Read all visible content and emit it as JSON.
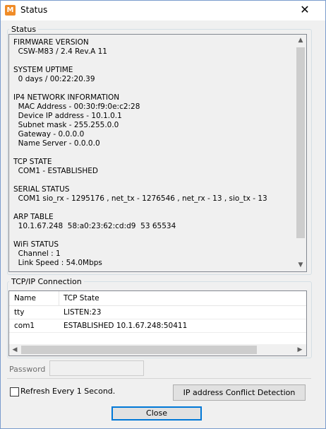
{
  "window": {
    "title": "Status",
    "icon_letter": "M"
  },
  "status_group": {
    "legend": "Status",
    "lines": [
      "FIRMWARE VERSION",
      "  CSW-M83 / 2.4 Rev.A 11",
      "",
      "SYSTEM UPTIME",
      "  0 days / 00:22:20.39",
      "",
      "IP4 NETWORK INFORMATION",
      "  MAC Address - 00:30:f9:0e:c2:28",
      "  Device IP address - 10.1.0.1",
      "  Subnet mask - 255.255.0.0",
      "  Gateway - 0.0.0.0",
      "  Name Server - 0.0.0.0",
      "",
      "TCP STATE",
      "  COM1 - ESTABLISHED",
      "",
      "SERIAL STATUS",
      "  COM1 sio_rx - 1295176 , net_tx - 1276546 , net_rx - 13 , sio_tx - 13",
      "",
      "ARP TABLE",
      "  10.1.67.248  58:a0:23:62:cd:d9  53 65534",
      "",
      "WiFi STATUS",
      "  Channel : 1",
      "  Link Speed : 54.0Mbps"
    ]
  },
  "tcp_group": {
    "legend": "TCP/IP Connection",
    "columns": [
      "Name",
      "TCP State"
    ],
    "rows": [
      {
        "name": "tty",
        "state": "LISTEN:23"
      },
      {
        "name": "com1",
        "state": "ESTABLISHED 10.1.67.248:50411"
      }
    ]
  },
  "password": {
    "label": "Password",
    "value": ""
  },
  "refresh": {
    "label": "Refresh Every 1 Second.",
    "checked": false
  },
  "buttons": {
    "ip_conflict": "IP address Conflict Detection",
    "close": "Close"
  },
  "icons": {
    "close": "close-icon",
    "scroll_up": "chevron-up-icon",
    "scroll_down": "chevron-down-icon",
    "scroll_left": "chevron-left-icon",
    "scroll_right": "chevron-right-icon"
  },
  "colors": {
    "app_icon": "#f08c28",
    "focus": "#0078d7"
  }
}
